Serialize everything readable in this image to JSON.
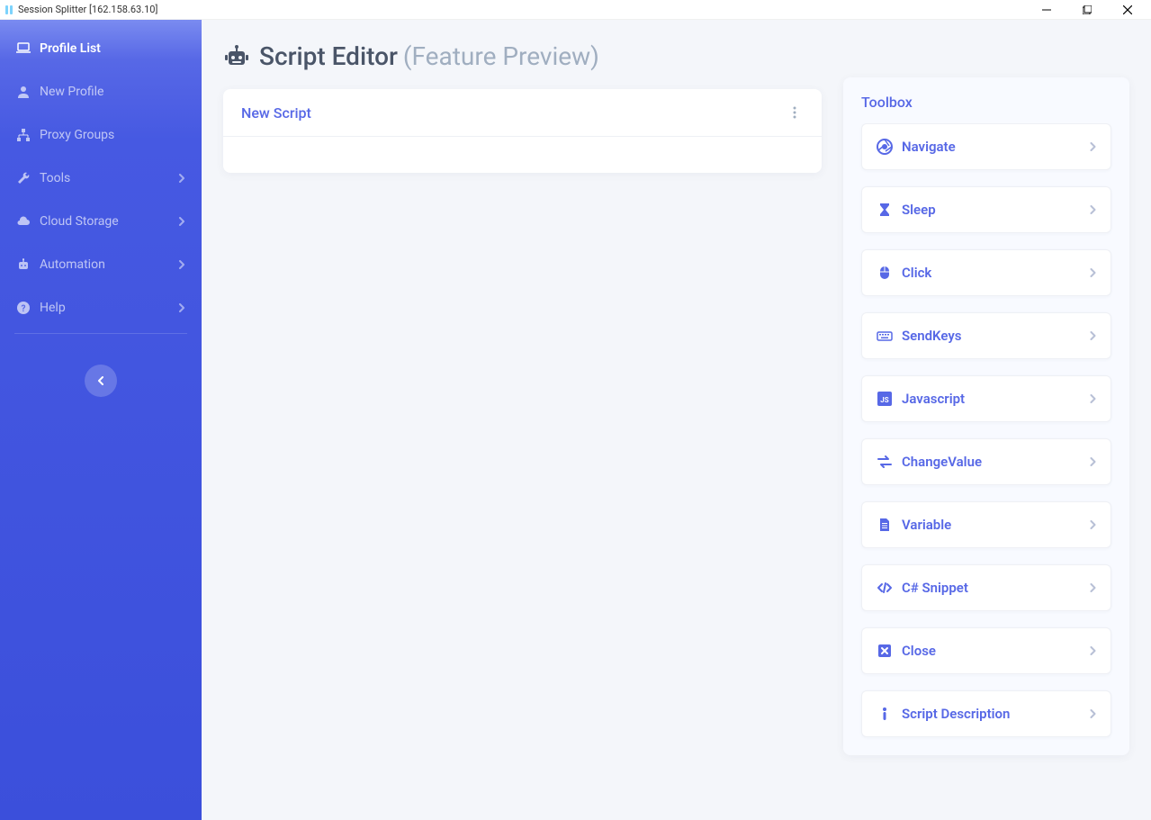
{
  "window": {
    "title": "Session Splitter [162.158.63.10]"
  },
  "sidebar": {
    "items": [
      {
        "label": "Profile List",
        "icon": "laptop-icon",
        "active": true,
        "expandable": false
      },
      {
        "label": "New Profile",
        "icon": "user-icon",
        "active": false,
        "expandable": false
      },
      {
        "label": "Proxy Groups",
        "icon": "sitemap-icon",
        "active": false,
        "expandable": false
      },
      {
        "label": "Tools",
        "icon": "wrench-icon",
        "active": false,
        "expandable": true
      },
      {
        "label": "Cloud Storage",
        "icon": "cloud-icon",
        "active": false,
        "expandable": true
      },
      {
        "label": "Automation",
        "icon": "robot-icon",
        "active": false,
        "expandable": true
      },
      {
        "label": "Help",
        "icon": "help-icon",
        "active": false,
        "expandable": true
      }
    ]
  },
  "page": {
    "title": "Script Editor",
    "subtitle": "(Feature Preview)"
  },
  "script_card": {
    "title": "New Script"
  },
  "toolbox": {
    "title": "Toolbox",
    "items": [
      {
        "label": "Navigate",
        "icon": "chrome-icon"
      },
      {
        "label": "Sleep",
        "icon": "hourglass-icon"
      },
      {
        "label": "Click",
        "icon": "mouse-icon"
      },
      {
        "label": "SendKeys",
        "icon": "keyboard-icon"
      },
      {
        "label": "Javascript",
        "icon": "js-icon"
      },
      {
        "label": "ChangeValue",
        "icon": "exchange-icon"
      },
      {
        "label": "Variable",
        "icon": "file-icon"
      },
      {
        "label": "C# Snippet",
        "icon": "code-icon"
      },
      {
        "label": "Close",
        "icon": "close-box-icon"
      },
      {
        "label": "Script Description",
        "icon": "info-icon"
      }
    ]
  }
}
